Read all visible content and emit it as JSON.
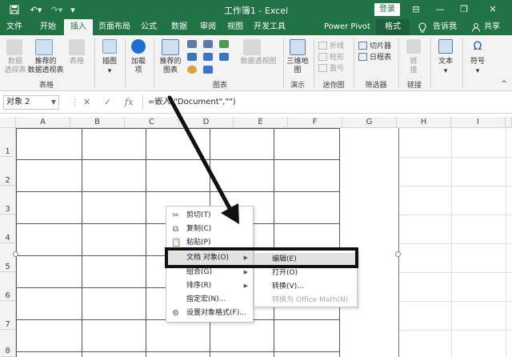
{
  "titlebar": {
    "title": "工作簿1  -  Excel",
    "login": "登录",
    "save_icon": "save-icon",
    "undo_icon": "undo-icon",
    "redo_icon": "redo-icon",
    "minimize": "—",
    "restore": "❐",
    "close": "✕",
    "ribbon_display": "⊟"
  },
  "tabs": [
    "文件",
    "开始",
    "插入",
    "页面布局",
    "公式",
    "数据",
    "审阅",
    "视图",
    "开发工具",
    "Power Pivot",
    "格式"
  ],
  "active_tab": "插入",
  "tellme": "告诉我",
  "share": "共享",
  "ribbon": {
    "pivot": "数据\n透视表",
    "recommended_pivot": "推荐的\n数据透视表",
    "table": "表格",
    "group_tables": "表格",
    "illustrations": "插图",
    "addins": "加载\n项",
    "recommended_charts": "推荐的\n图表",
    "pivot_chart": "数据透视图",
    "group_charts": "图表",
    "map3d": "三维地\n图",
    "group_tours": "演示",
    "sparkline_line": "折线",
    "sparkline_column": "柱形",
    "sparkline_winloss": "盈亏",
    "group_sparklines": "迷你图",
    "slicer": "切片器",
    "timeline": "日程表",
    "group_filters": "筛选器",
    "link": "链\n接",
    "group_links": "链接",
    "text": "文本",
    "symbol": "符号"
  },
  "formula_bar": {
    "name_box": "对象 2",
    "cancel": "✕",
    "enter": "✓",
    "fx": "fx",
    "formula": "=嵌入(\"Document\",\"\")"
  },
  "columns": [
    "A",
    "B",
    "C",
    "D",
    "E",
    "F",
    "G",
    "H",
    "I"
  ],
  "rows": [
    "1",
    "2",
    "3",
    "4",
    "5",
    "6",
    "7",
    "8"
  ],
  "context_menu": {
    "items": [
      {
        "label": "剪切(T)",
        "icon": "scissors-icon",
        "has_submenu": false
      },
      {
        "label": "复制(C)",
        "icon": "copy-icon",
        "has_submenu": false
      },
      {
        "label": "粘贴(P)",
        "icon": "paste-icon",
        "has_submenu": false
      },
      {
        "label": "文档 对象(O)",
        "icon": "",
        "has_submenu": true
      },
      {
        "label": "组合(G)",
        "icon": "",
        "has_submenu": true
      },
      {
        "label": "排序(R)",
        "icon": "",
        "has_submenu": true
      },
      {
        "label": "指定宏(N)...",
        "icon": "",
        "has_submenu": false
      },
      {
        "label": "设置对象格式(F)...",
        "icon": "format-object-icon",
        "has_submenu": false
      }
    ]
  },
  "submenu": {
    "items": [
      {
        "label": "编辑(E)",
        "enabled": true
      },
      {
        "label": "打开(O)",
        "enabled": true
      },
      {
        "label": "转换(V)...",
        "enabled": true
      },
      {
        "label": "转换为 Office Math(N)",
        "enabled": false
      }
    ]
  },
  "colors": {
    "excel_green": "#217346",
    "annotation": "#111111"
  }
}
